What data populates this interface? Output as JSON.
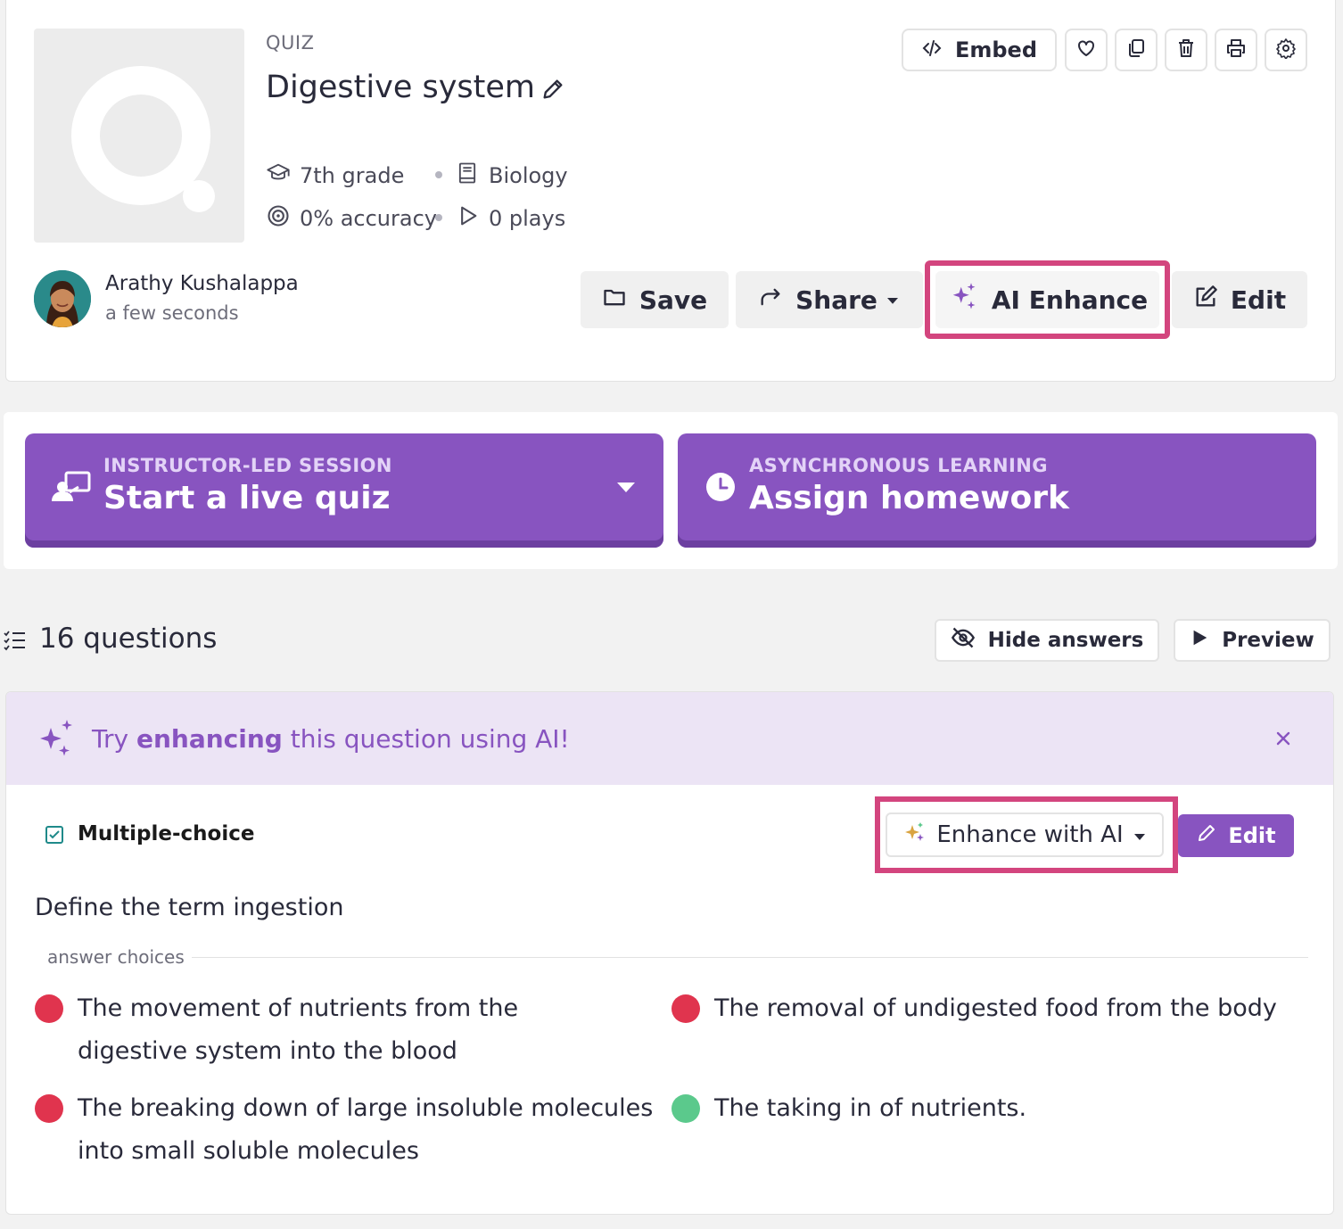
{
  "quiz": {
    "type_label": "QUIZ",
    "title": "Digestive system",
    "grade": "7th grade",
    "subject": "Biology",
    "accuracy": "0% accuracy",
    "plays": "0 plays"
  },
  "toolbar": {
    "embed_label": "Embed",
    "icons": [
      "heart-icon",
      "copy-icon",
      "trash-icon",
      "print-icon",
      "gear-icon"
    ]
  },
  "author": {
    "name": "Arathy Kushalappa",
    "time": "a few seconds"
  },
  "actions": {
    "save": "Save",
    "share": "Share",
    "ai_enhance": "AI Enhance",
    "edit": "Edit"
  },
  "session": {
    "live": {
      "small": "INSTRUCTOR-LED SESSION",
      "big": "Start a live quiz"
    },
    "homework": {
      "small": "ASYNCHRONOUS LEARNING",
      "big": "Assign homework"
    }
  },
  "questions_bar": {
    "count": "16 questions",
    "hide_answers": "Hide answers",
    "preview": "Preview"
  },
  "banner": {
    "pre": "Try ",
    "bold": "enhancing",
    "post": " this question using AI!"
  },
  "question": {
    "type": "Multiple-choice",
    "enhance_label": "Enhance with AI",
    "edit_label": "Edit",
    "text": "Define the term ingestion",
    "answers_label": "answer choices",
    "choices": [
      {
        "text": "The movement of nutrients from the digestive system into the blood",
        "correct": false
      },
      {
        "text": "The removal of undigested food from the body",
        "correct": false
      },
      {
        "text": "The breaking down of large insoluble molecules into small soluble molecules",
        "correct": false
      },
      {
        "text": "The taking in of nutrients.",
        "correct": true
      }
    ]
  },
  "colors": {
    "brand_purple": "#8854c0",
    "highlight_pink": "#d3457e",
    "wrong": "#e0344e",
    "correct": "#5bc98c",
    "banner_bg": "#ece4f5"
  }
}
